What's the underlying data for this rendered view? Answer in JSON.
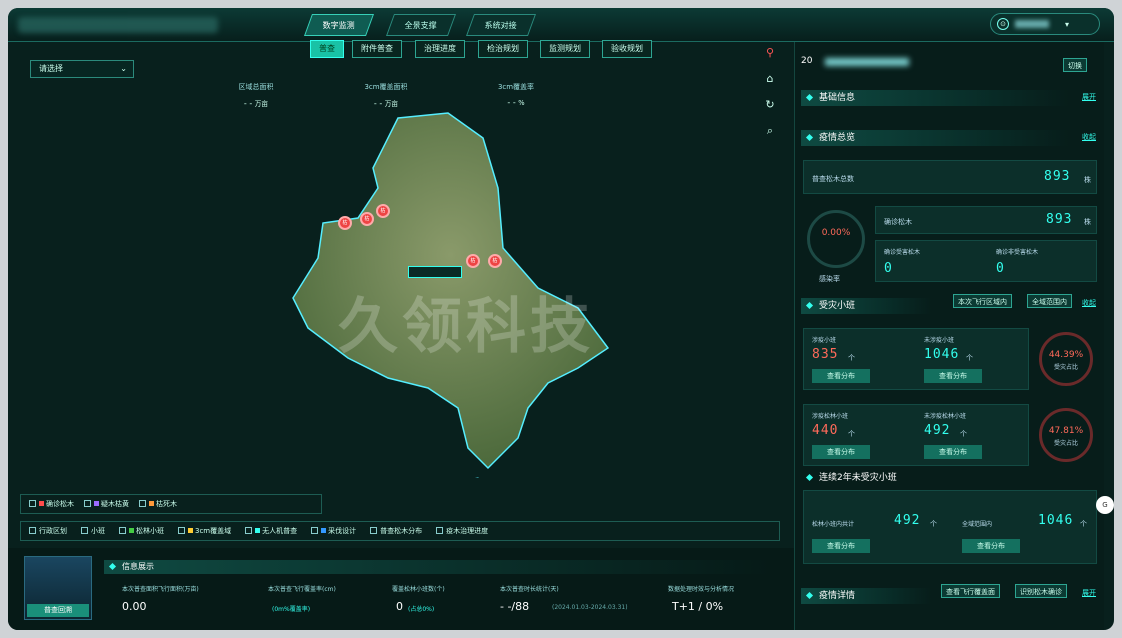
{
  "top_tabs": [
    "数字监测",
    "全景支撑",
    "系统对接"
  ],
  "sub_tabs": [
    "普查",
    "附件普查",
    "治理进度",
    "检治规划",
    "监测规划",
    "验收规划"
  ],
  "region_select": "请选择",
  "stats": [
    {
      "label": "区域总面积",
      "value": "- -",
      "unit": "万亩"
    },
    {
      "label": "3cm覆盖面积",
      "value": "- -",
      "unit": "万亩"
    },
    {
      "label": "3cm覆盖率",
      "value": "- -",
      "unit": "%"
    }
  ],
  "watermark": "久领科技",
  "map_pins": [
    "枯",
    "枯",
    "枯",
    "枯",
    "枯"
  ],
  "right": {
    "year": "20",
    "switch": "切换",
    "basic": "基础信息",
    "expand": "展开",
    "epidemic": "疫情总览",
    "collapse": "收起",
    "total_label": "普查松木总数",
    "total": "893",
    "unit_ke": "株",
    "ring_pct": "0.00%",
    "ring_label": "感染率",
    "confirm_label": "确诊松木",
    "confirm": "893",
    "sub1_label": "确诊受害松木",
    "sub1": "0",
    "sub2_label": "确诊非受害松木",
    "sub2": "0",
    "xiaoban": "受灾小班",
    "btn_a": "本次飞行区域内",
    "btn_b": "全域范围内",
    "c1_label": "涉疫小班",
    "c1": "835",
    "c2_label": "未涉疫小班",
    "c2": "1046",
    "r1_pct": "44.39%",
    "r1_label": "受灾占比",
    "c3_label": "涉疫松林小班",
    "c3": "440",
    "c4_label": "未涉疫松林小班",
    "c4": "492",
    "r2_pct": "47.81%",
    "r2_label": "受灾占比",
    "unit_ge": "个",
    "btn_view": "查看分布",
    "two_year": "连续2年未受灾小班",
    "c5_label": "松林小班内共计",
    "c5": "492",
    "c6_label": "全域范围内",
    "c6": "1046",
    "detail": "疫情详情",
    "btn_c": "查看飞行覆盖面",
    "btn_d": "识别松木确诊",
    "expand2": "展开"
  },
  "legend": [
    "确诊松木",
    "疑木枯黄",
    "枯死木"
  ],
  "legend_colors": [
    "#ff4b4b",
    "#9b6bff",
    "#ff9a3a"
  ],
  "layers": [
    "行政区划",
    "小班",
    "松林小班",
    "3cm覆盖域",
    "无人机普查",
    "采伐设计",
    "普查松木分布",
    "疫木治理进度"
  ],
  "thumb_label": "普查回溯",
  "info": {
    "title": "信息展示",
    "items": [
      {
        "label": "本次普查面积飞行面积(万亩)",
        "value": "0.00",
        "sub": ""
      },
      {
        "label": "本次普查飞行覆盖率(cm)",
        "value": "",
        "sub": "(0m%覆盖率)"
      },
      {
        "label": "覆盖松林小班数(个)",
        "value": "0",
        "sub": "(占总0%)"
      },
      {
        "label": "本次普查时长统计(天)",
        "value": "- -/88",
        "sub": "(2024.01.03-2024.03.31)"
      },
      {
        "label": "数据处理时效与分析情况",
        "value": "T+1 / 0%",
        "sub": ""
      }
    ]
  }
}
